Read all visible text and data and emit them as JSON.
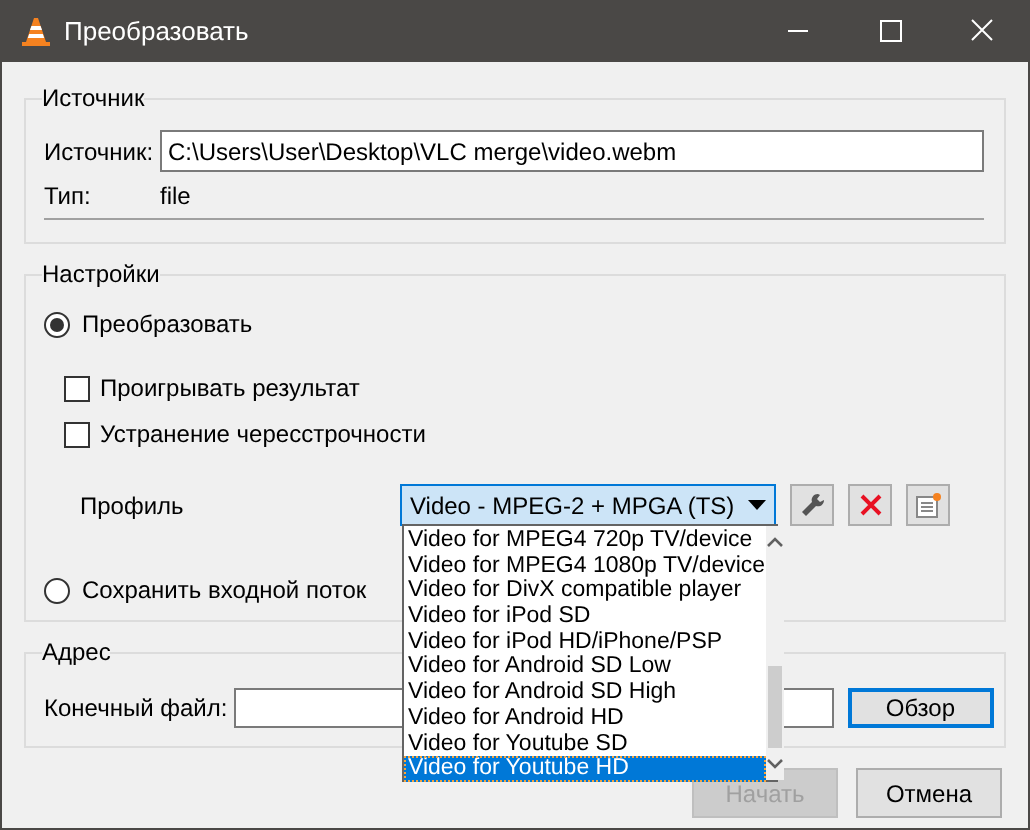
{
  "window": {
    "title": "Преобразовать"
  },
  "source_group": {
    "title": "Источник",
    "source_label": "Источник:",
    "source_value": "C:\\Users\\User\\Desktop\\VLC merge\\video.webm",
    "type_label": "Тип:",
    "type_value": "file"
  },
  "settings_group": {
    "title": "Настройки",
    "modes": [
      {
        "label": "Преобразовать",
        "selected": true
      },
      {
        "label": "Сохранить входной поток",
        "selected": false
      }
    ],
    "options": [
      {
        "label": "Проигрывать результат",
        "checked": false
      },
      {
        "label": "Устранение чересстрочности",
        "checked": false
      }
    ],
    "profile_label": "Профиль",
    "profile_value": "Video - MPEG-2 + MPGA (TS)",
    "profile_list_open": true,
    "profile_options": [
      {
        "label": "Video for MPEG4 720p TV/device",
        "selected": false
      },
      {
        "label": "Video for MPEG4 1080p TV/device",
        "selected": false
      },
      {
        "label": "Video for DivX compatible player",
        "selected": false
      },
      {
        "label": "Video for iPod SD",
        "selected": false
      },
      {
        "label": "Video for iPod HD/iPhone/PSP",
        "selected": false
      },
      {
        "label": "Video for Android SD Low",
        "selected": false
      },
      {
        "label": "Video for Android SD High",
        "selected": false
      },
      {
        "label": "Video for Android HD",
        "selected": false
      },
      {
        "label": "Video for Youtube SD",
        "selected": false
      },
      {
        "label": "Video for Youtube HD",
        "selected": true
      }
    ]
  },
  "destination_group": {
    "title": "Адрес",
    "file_label": "Конечный файл:",
    "browse_button": "Обзор"
  },
  "buttons": [
    {
      "label": "Начать",
      "disabled": true
    },
    {
      "label": "Отмена",
      "disabled": false
    }
  ]
}
